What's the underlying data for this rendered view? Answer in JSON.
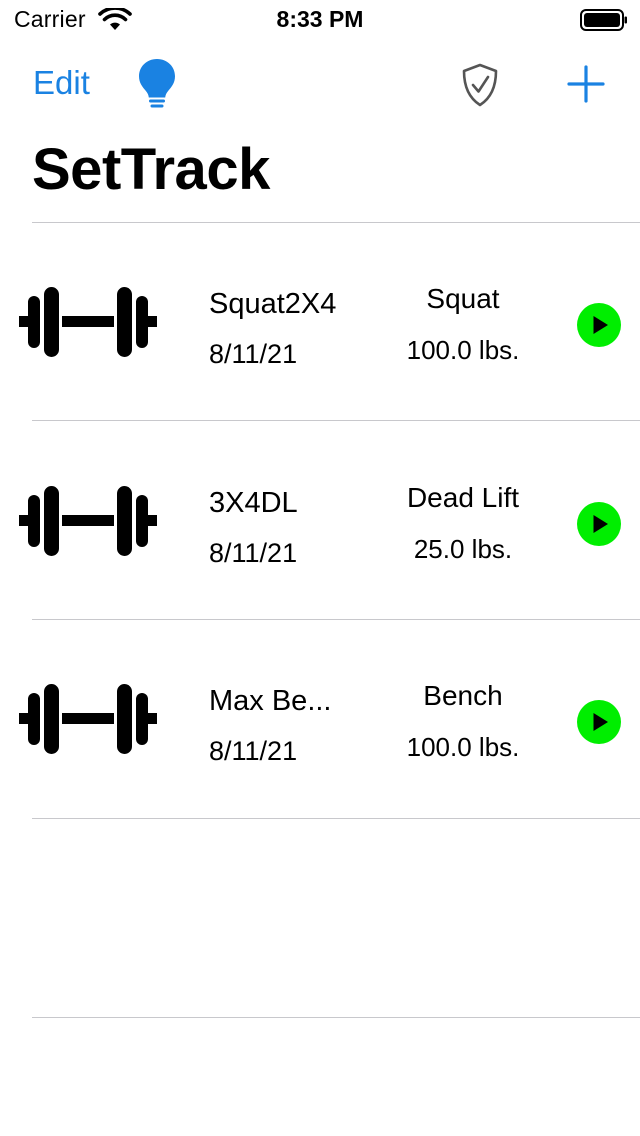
{
  "status_bar": {
    "carrier": "Carrier",
    "time": "8:33 PM"
  },
  "nav": {
    "edit_label": "Edit",
    "accent_color": "#1a82e2",
    "icons": [
      "lightbulb-icon",
      "shield-check-icon",
      "plus-icon"
    ]
  },
  "title": "SetTrack",
  "workouts": [
    {
      "name": "Squat2X4",
      "date": "8/11/21",
      "exercise": "Squat",
      "weight": "100.0 lbs."
    },
    {
      "name": "3X4DL",
      "date": "8/11/21",
      "exercise": "Dead Lift",
      "weight": "25.0 lbs."
    },
    {
      "name": "Max Be...",
      "date": "8/11/21",
      "exercise": "Bench",
      "weight": "100.0 lbs."
    }
  ],
  "play_button_color": "#00ee00"
}
